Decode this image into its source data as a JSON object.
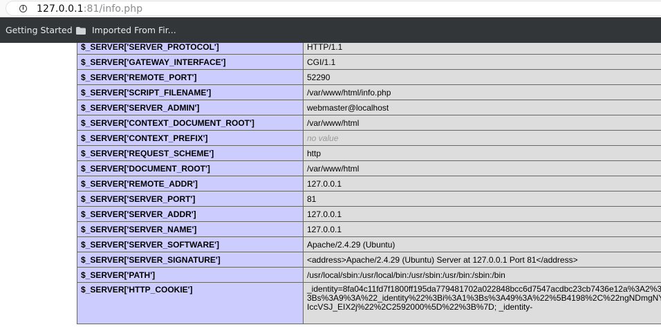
{
  "browser": {
    "url_host": "127.0.0.1",
    "url_rest": ":81/info.php",
    "bookmarks": [
      "Getting Started",
      "Imported From Fir..."
    ]
  },
  "server_vars": [
    {
      "key": "$_SERVER['SERVER_PROTOCOL']",
      "value": "HTTP/1.1"
    },
    {
      "key": "$_SERVER['GATEWAY_INTERFACE']",
      "value": "CGI/1.1"
    },
    {
      "key": "$_SERVER['REMOTE_PORT']",
      "value": "52290"
    },
    {
      "key": "$_SERVER['SCRIPT_FILENAME']",
      "value": "/var/www/html/info.php"
    },
    {
      "key": "$_SERVER['SERVER_ADMIN']",
      "value": "webmaster@localhost"
    },
    {
      "key": "$_SERVER['CONTEXT_DOCUMENT_ROOT']",
      "value": "/var/www/html"
    },
    {
      "key": "$_SERVER['CONTEXT_PREFIX']",
      "value": "no value"
    },
    {
      "key": "$_SERVER['REQUEST_SCHEME']",
      "value": "http"
    },
    {
      "key": "$_SERVER['DOCUMENT_ROOT']",
      "value": "/var/www/html"
    },
    {
      "key": "$_SERVER['REMOTE_ADDR']",
      "value": "127.0.0.1"
    },
    {
      "key": "$_SERVER['SERVER_PORT']",
      "value": "81"
    },
    {
      "key": "$_SERVER['SERVER_ADDR']",
      "value": "127.0.0.1"
    },
    {
      "key": "$_SERVER['SERVER_NAME']",
      "value": "127.0.0.1"
    },
    {
      "key": "$_SERVER['SERVER_SOFTWARE']",
      "value": "Apache/2.4.29 (Ubuntu)"
    },
    {
      "key": "$_SERVER['SERVER_SIGNATURE']",
      "value": "<address>Apache/2.4.29 (Ubuntu) Server at 127.0.0.1 Port 81</address>"
    },
    {
      "key": "$_SERVER['PATH']",
      "value": "/usr/local/sbin:/usr/local/bin:/usr/sbin:/usr/bin:/sbin:/bin"
    }
  ],
  "cookie": {
    "key": "$_SERVER['HTTP_COOKIE']",
    "lines": [
      "_identity=8fa04c11fd7f1800ff195da779481702a022848bcc6d7547acdbc23cb7436e12a%3A2%3",
      "3Bs%3A9%3A%22_identity%22%3Bi%3A1%3Bs%3A49%3A%22%5B4198%2C%22ngNDmgNY",
      "IccVSJ_EIX2j%22%2C2592000%5D%22%3B%7D; _identity-"
    ]
  },
  "novalue_text": "no value"
}
